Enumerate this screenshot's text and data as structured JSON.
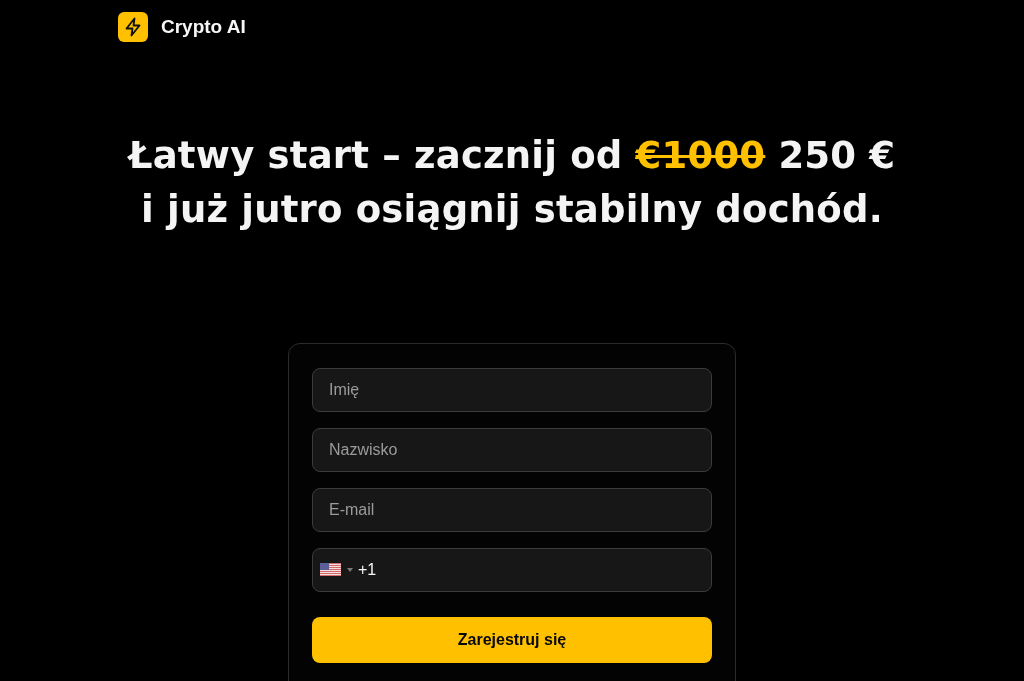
{
  "header": {
    "brand": "Crypto AI"
  },
  "headline": {
    "lead": "Łatwy start – zacznij od",
    "old_price": "€1000",
    "new_price": "250 €",
    "line_2": "i już jutro osiągnij stabilny dochód."
  },
  "form": {
    "fields": [
      {
        "kind": "text",
        "placeholder": "Imię"
      },
      {
        "kind": "text",
        "placeholder": "Nazwisko"
      },
      {
        "kind": "text",
        "placeholder": "E-mail"
      },
      {
        "kind": "phone",
        "value": "+1"
      }
    ],
    "submit": "Zarejestruj się"
  }
}
